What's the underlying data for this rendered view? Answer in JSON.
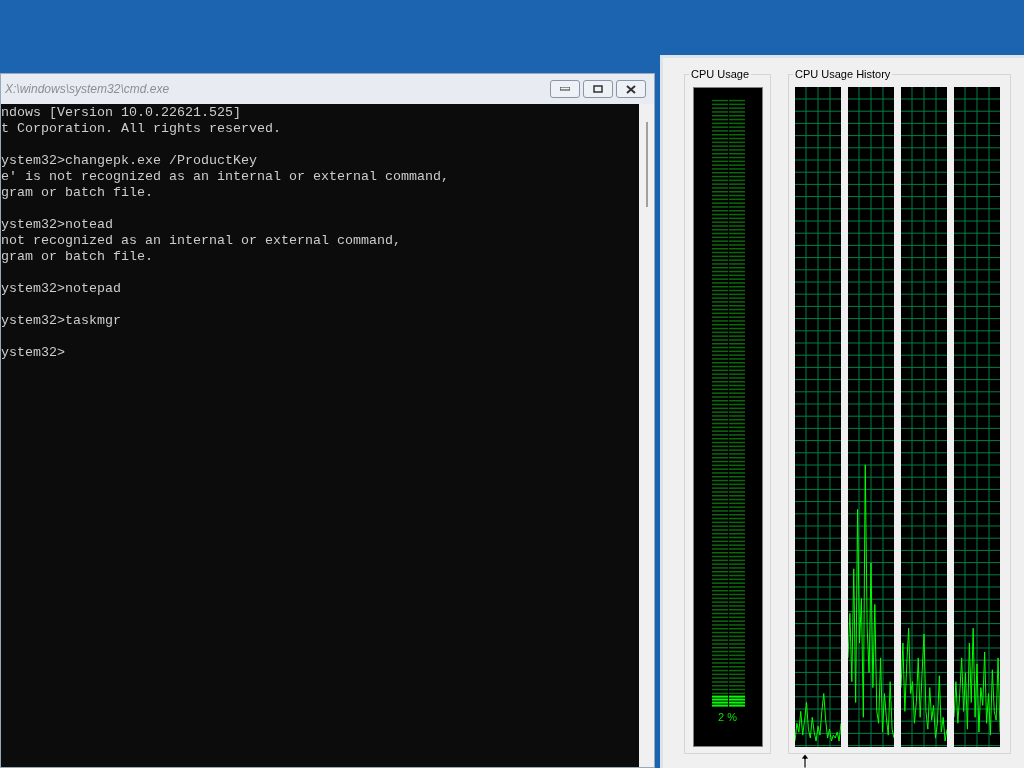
{
  "console_window": {
    "title": "X:\\windows\\system32\\cmd.exe",
    "blocks": [
      [
        "ndows [Version 10.0.22621.525]",
        "t Corporation. All rights reserved."
      ],
      [
        "ystem32>changepk.exe /ProductKey",
        "e' is not recognized as an internal or external command,",
        "gram or batch file."
      ],
      [
        "ystem32>notead",
        "not recognized as an internal or external command,",
        "gram or batch file."
      ],
      [
        "ystem32>notepad"
      ],
      [
        "ystem32>taskmgr"
      ],
      [
        "ystem32>"
      ]
    ]
  },
  "task_manager": {
    "cpu_usage": {
      "label": "CPU Usage",
      "level": 0.02,
      "reading": "2 %"
    },
    "cpu_usage_history": {
      "label": "CPU Usage History"
    }
  }
}
